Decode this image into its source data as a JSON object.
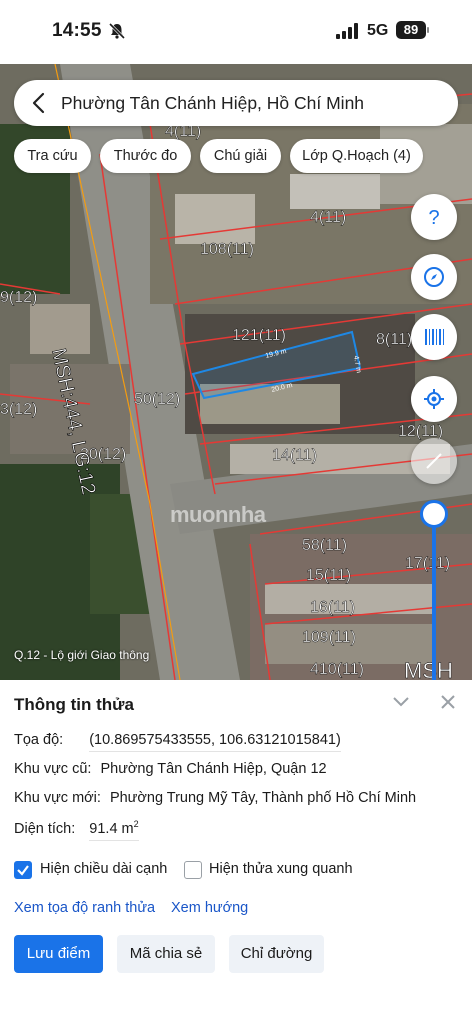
{
  "status_bar": {
    "time": "14:55",
    "network": "5G",
    "battery": "89"
  },
  "map": {
    "search": {
      "title": "Phường Tân Chánh Hiệp, Hồ Chí Minh"
    },
    "chips": [
      "Tra cứu",
      "Thước đo",
      "Chú giải",
      "Lớp Q.Hoạch (4)"
    ],
    "controls": {
      "help": "help-icon",
      "compass": "compass-icon",
      "barcode": "barcode-icon",
      "locate": "my-location-icon",
      "layer": "layer-toggle-icon"
    },
    "labels": {
      "road": "MSH:444, LG:12",
      "legend_note": "Q.12 - Lộ giới Giao thông",
      "watermark": "muonnha",
      "road_right": "MSH",
      "parcels": [
        "4(11)",
        "108(11)",
        "121(11)",
        "8(11)",
        "12(11)",
        "50(12)",
        "3(12)",
        "20(12)",
        "14(11)",
        "58(11)",
        "15(11)",
        "16(11)",
        "109(11)",
        "410(11)",
        "9(12)",
        "17(11)",
        "4(11)"
      ],
      "dims": [
        "19.9 m",
        "20.0 m",
        "4.7 m"
      ]
    },
    "colors": {
      "accent": "#1a73e8",
      "boundary": "#e53935",
      "selected": "#1e88e5"
    }
  },
  "sheet": {
    "title": "Thông tin thửa",
    "coords_label": "Tọa độ:",
    "coords_value": "(10.869575433555, 106.63121015841)",
    "old_area_label": "Khu vực cũ:",
    "old_area_value": "Phường Tân Chánh Hiệp, Quận 12",
    "new_area_label": "Khu vực mới:",
    "new_area_value": "Phường Trung Mỹ Tây, Thành phố Hồ Chí Minh",
    "area_label": "Diện tích:",
    "area_value": "91.4 m",
    "area_unit_sup": "2",
    "checkbox_edges": {
      "label": "Hiện chiều dài cạnh",
      "checked": true
    },
    "checkbox_neighbors": {
      "label": "Hiện thửa xung quanh",
      "checked": false
    },
    "link_boundary": "Xem tọa độ ranh thửa",
    "link_direction": "Xem hướng",
    "buttons": {
      "save": "Lưu điểm",
      "share": "Mã chia sẻ",
      "directions": "Chỉ đường"
    }
  }
}
